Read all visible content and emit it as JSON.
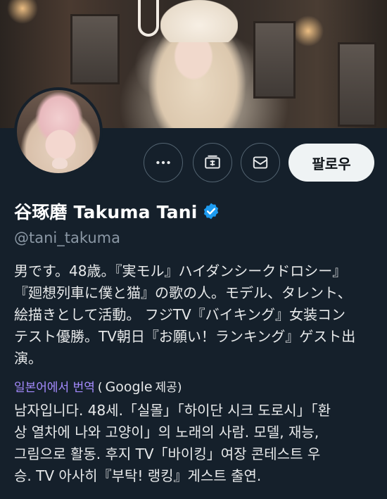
{
  "profile": {
    "display_name": "谷琢磨 Takuma Tani",
    "handle": "@tani_takuma",
    "verified": true
  },
  "actions": {
    "more_icon": "more-horizontal-icon",
    "subscribe_icon": "subscribe-icon",
    "message_icon": "envelope-icon",
    "follow_label": "팔로우"
  },
  "bio": {
    "text": "男です。48歳。『実モル』ハイダンシークドロシー』\n『廻想列車に僕と猫』の歌の人。モデル、タレント、\n絵描きとして活動。 フジTV『バイキング』女装コン\nテスト優勝。TV朝日『お願い！ランキング』ゲスト出\n演。"
  },
  "translation": {
    "link_text": "일본어에서 번역",
    "open_paren": "(",
    "provider": "Google",
    "provided_by": "제공)",
    "text": "남자입니다. 48세.「실몰」「하이단 시크 도로시」「환\n상 열차에 나와 고양이」의 노래의 사람. 모델, 재능,\n그림으로 활동. 후지 TV「바이킹」여장 콘테스트 우\n승. TV 아사히『부탁! 랭킹』게스트 출연."
  },
  "colors": {
    "background": "#15202b",
    "verified_blue": "#1d9bf0",
    "translate_link": "#a58bff",
    "follow_bg": "#eff3f4"
  }
}
